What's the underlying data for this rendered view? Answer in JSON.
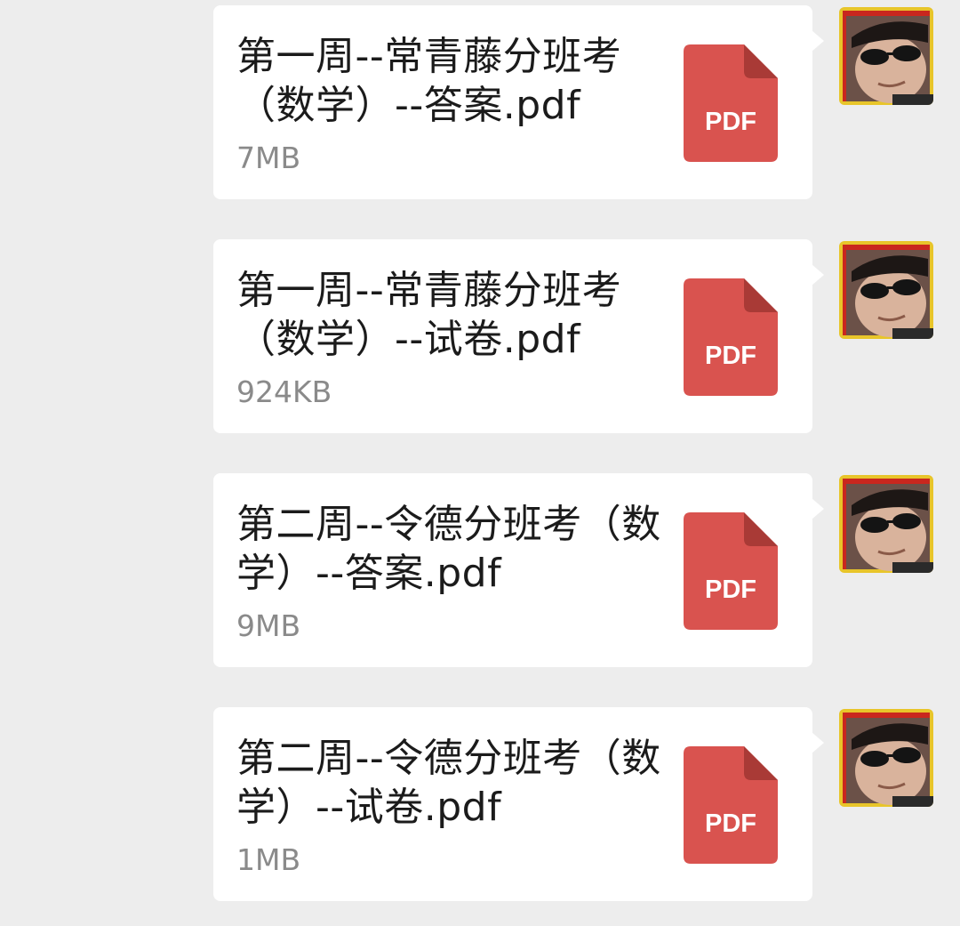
{
  "colors": {
    "background": "#ededed",
    "bubble": "#ffffff",
    "pdf_icon": "#d9534f",
    "pdf_fold": "#a93a36",
    "file_name_text": "#1b1b1b",
    "file_size_text": "#8a8a8a"
  },
  "pdf_icon_label": "PDF",
  "messages": [
    {
      "file_name": "第一周--常青藤分班考（数学）--答案.pdf",
      "file_size": "7MB",
      "icon": "pdf-file-icon"
    },
    {
      "file_name": "第一周--常青藤分班考（数学）--试卷.pdf",
      "file_size": "924KB",
      "icon": "pdf-file-icon"
    },
    {
      "file_name": "第二周--令德分班考（数学）--答案.pdf",
      "file_size": "9MB",
      "icon": "pdf-file-icon"
    },
    {
      "file_name": "第二周--令德分班考（数学）--试卷.pdf",
      "file_size": "1MB",
      "icon": "pdf-file-icon"
    }
  ]
}
